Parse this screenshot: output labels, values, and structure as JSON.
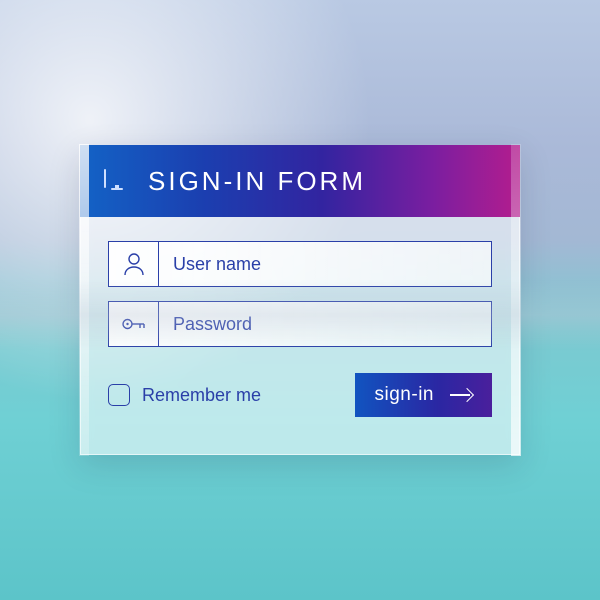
{
  "header": {
    "title": "SIGN-IN FORM"
  },
  "fields": {
    "username": {
      "placeholder": "User name",
      "value": ""
    },
    "password": {
      "placeholder": "Password",
      "value": ""
    }
  },
  "remember": {
    "label": "Remember me",
    "checked": false
  },
  "actions": {
    "signin_label": "sign-in"
  },
  "colors": {
    "accent": "#2a3fa8",
    "header_gradient_start": "#1363c6",
    "header_gradient_end": "#b41d8e"
  }
}
